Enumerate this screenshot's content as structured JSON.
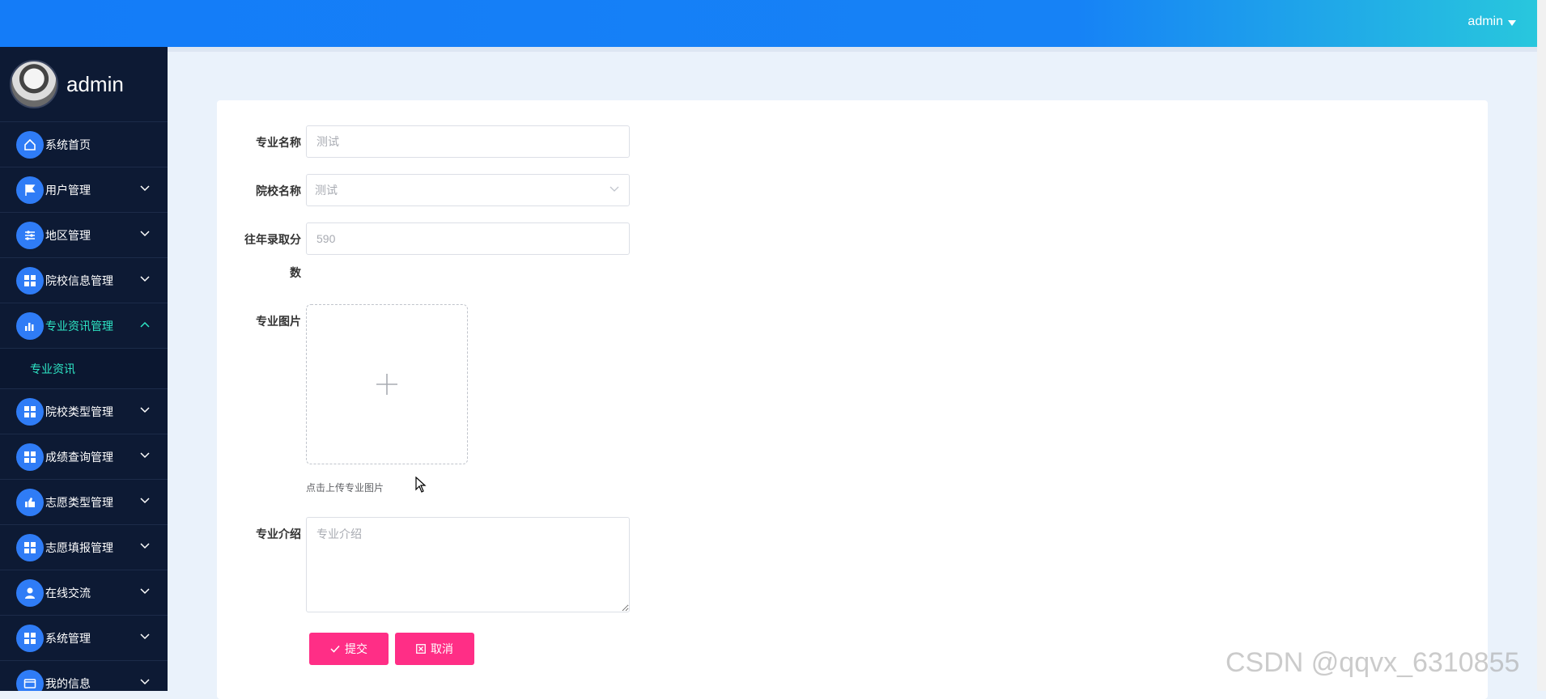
{
  "header": {
    "username": "admin",
    "gradient_start": "#147cf8",
    "gradient_end": "#28c7dd"
  },
  "sidebar": {
    "profile_name": "admin",
    "background": "#0d1a34",
    "active_color": "#2ee6c5",
    "items": [
      {
        "label": "系统首页",
        "icon": "home-icon",
        "has_children": false
      },
      {
        "label": "用户管理",
        "icon": "flag-icon",
        "has_children": true
      },
      {
        "label": "地区管理",
        "icon": "sliders-icon",
        "has_children": true
      },
      {
        "label": "院校信息管理",
        "icon": "grid-icon",
        "has_children": true
      },
      {
        "label": "专业资讯管理",
        "icon": "bar-chart-icon",
        "has_children": true,
        "expanded": true,
        "active": true
      },
      {
        "label": "院校类型管理",
        "icon": "grid-icon",
        "has_children": true
      },
      {
        "label": "成绩查询管理",
        "icon": "grid-icon",
        "has_children": true
      },
      {
        "label": "志愿类型管理",
        "icon": "thumbs-up-icon",
        "has_children": true
      },
      {
        "label": "志愿填报管理",
        "icon": "grid-icon",
        "has_children": true
      },
      {
        "label": "在线交流",
        "icon": "user-icon",
        "has_children": true
      },
      {
        "label": "系统管理",
        "icon": "grid-icon",
        "has_children": true
      },
      {
        "label": "我的信息",
        "icon": "card-icon",
        "has_children": true
      }
    ],
    "submenu": {
      "label": "专业资讯"
    }
  },
  "form": {
    "major_name": {
      "label": "专业名称",
      "placeholder": "测试"
    },
    "school_name": {
      "label": "院校名称",
      "selected": "测试"
    },
    "score": {
      "label_line1": "往年录取分",
      "label_line2": "数",
      "placeholder": "590"
    },
    "image": {
      "label": "专业图片",
      "tip": "点击上传专业图片"
    },
    "intro": {
      "label": "专业介绍",
      "placeholder": "专业介绍"
    },
    "submit_label": "提交",
    "cancel_label": "取消",
    "button_color": "#ff2e86"
  },
  "watermark": "CSDN @qqvx_6310855"
}
